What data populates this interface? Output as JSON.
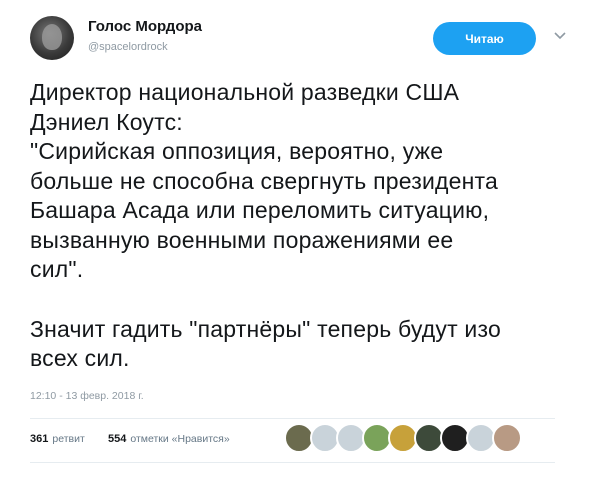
{
  "user": {
    "name": "Голос Мордора",
    "handle": "@spacelordrock"
  },
  "follow_button_label": "Читаю",
  "tweet": {
    "paragraph1_lines": [
      "Директор национальной разведки США",
      "Дэниел Коутс:",
      "\"Сирийская оппозиция, вероятно, уже",
      "больше не способна свергнуть президента",
      "Башара Асада или переломить ситуацию,",
      "вызванную военными поражениями ее",
      "сил\"."
    ],
    "paragraph2_lines": [
      "Значит гадить \"партнёры\" теперь будут изо",
      "всех сил."
    ]
  },
  "timestamp": "12:10 - 13 февр. 2018 г.",
  "stats": {
    "retweets_count": "361",
    "retweets_label": "ретвит",
    "likes_count": "554",
    "likes_label": "отметки «Нравится»"
  },
  "icons": {
    "chevron": "chevron-down-icon",
    "avatar": "user-avatar"
  },
  "colors": {
    "accent": "#1da1f2",
    "text": "#14171a",
    "muted": "#8f9aa3"
  },
  "liker_avatars": [
    {
      "color": "#6b6b4e"
    },
    {
      "color": "#c9d3da"
    },
    {
      "color": "#c9d3da"
    },
    {
      "color": "#7aa35a"
    },
    {
      "color": "#c7a13a"
    },
    {
      "color": "#3d4a3a"
    },
    {
      "color": "#1f1f1f"
    },
    {
      "color": "#c9d3da"
    },
    {
      "color": "#b89a84"
    }
  ]
}
